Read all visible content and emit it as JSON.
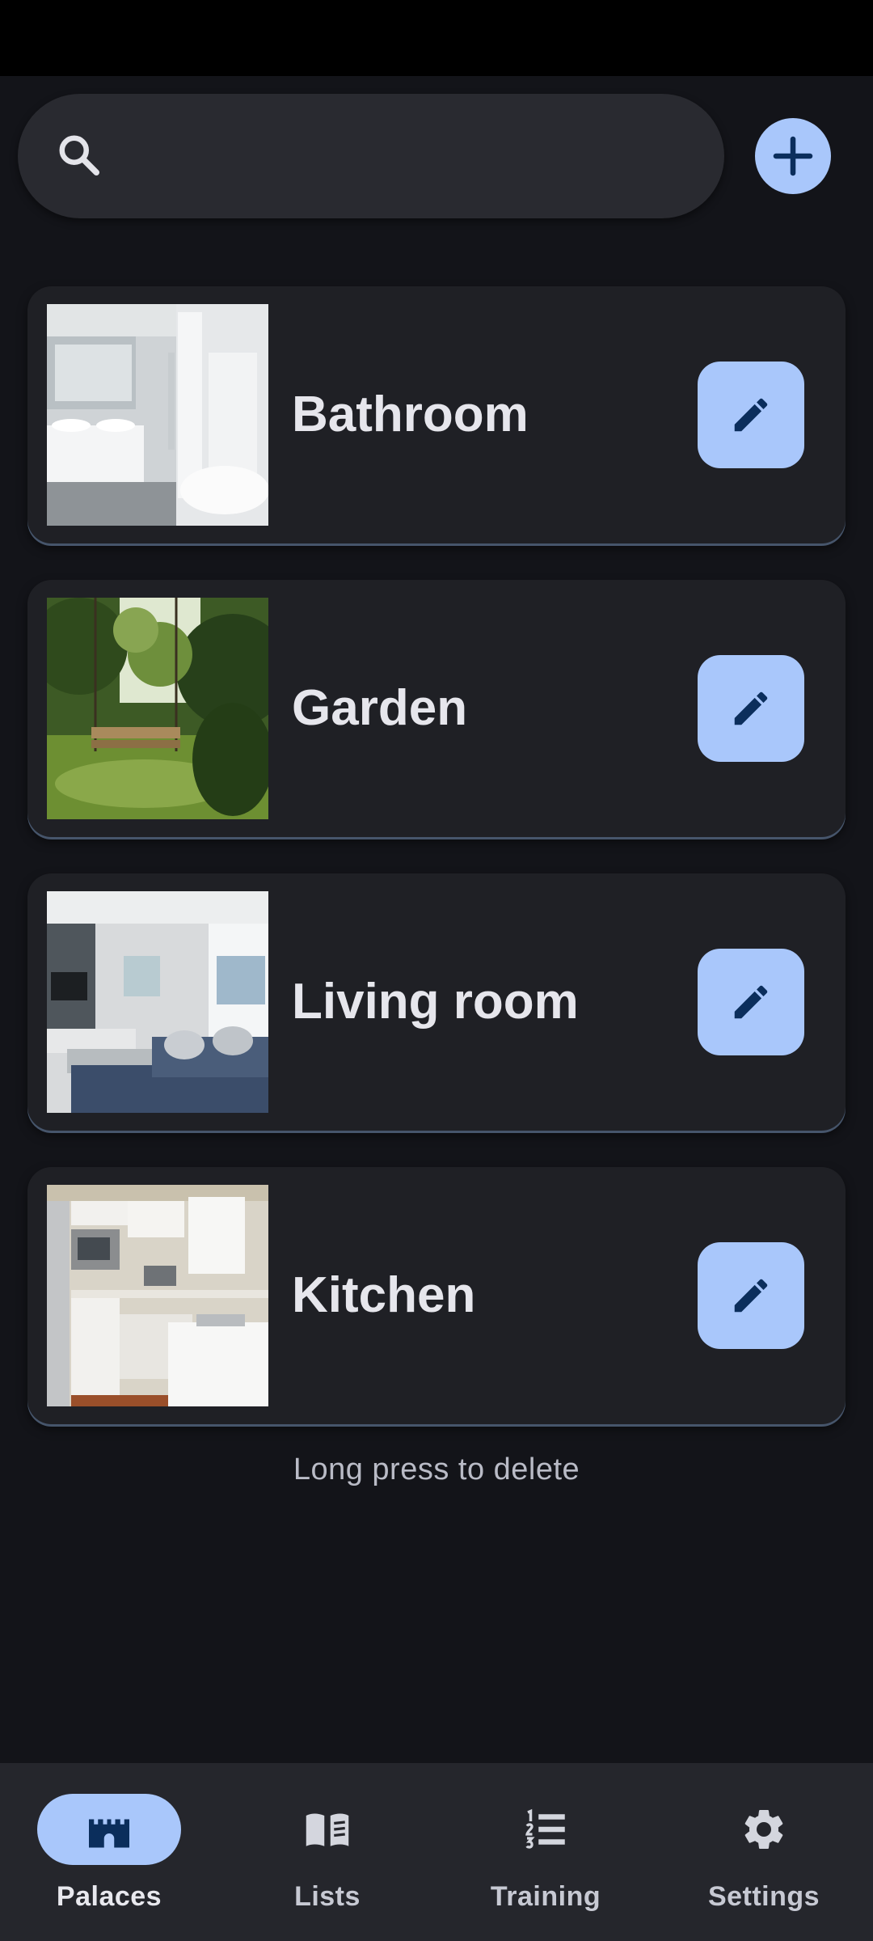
{
  "search": {
    "value": "",
    "placeholder": ""
  },
  "toolbar": {
    "add_icon": "plus-icon"
  },
  "palaces": [
    {
      "name": "Bathroom",
      "thumbnail": "bathroom-photo"
    },
    {
      "name": "Garden",
      "thumbnail": "garden-swing-photo"
    },
    {
      "name": "Living room",
      "thumbnail": "living-room-photo"
    },
    {
      "name": "Kitchen",
      "thumbnail": "kitchen-photo"
    }
  ],
  "hint": "Long press to delete",
  "nav": {
    "active": "Palaces",
    "items": [
      {
        "label": "Palaces",
        "icon": "castle-icon"
      },
      {
        "label": "Lists",
        "icon": "book-icon"
      },
      {
        "label": "Training",
        "icon": "numbered-list-icon"
      },
      {
        "label": "Settings",
        "icon": "gear-icon"
      }
    ]
  },
  "colors": {
    "background": "#131419",
    "card": "#1f2025",
    "accent": "#a9c7fb",
    "accent_on": "#0b2e5c",
    "text": "#e6e6ec"
  }
}
